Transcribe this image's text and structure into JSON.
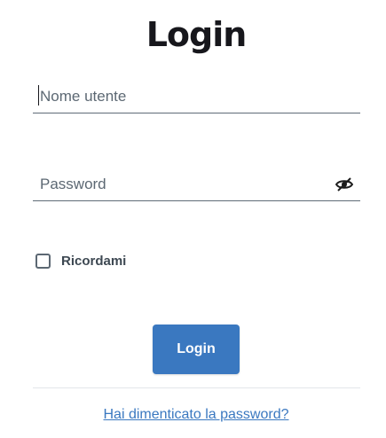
{
  "title": "Login",
  "username": {
    "placeholder": "Nome utente",
    "value": ""
  },
  "password": {
    "placeholder": "Password",
    "value": "",
    "toggle_icon": "eye-slash-icon"
  },
  "remember": {
    "label": "Ricordami",
    "checked": false
  },
  "login_button": "Login",
  "forgot_link": "Hai dimenticato la password?",
  "colors": {
    "accent": "#3a78c0",
    "title": "#17171c",
    "field_border": "#5f6b77"
  }
}
